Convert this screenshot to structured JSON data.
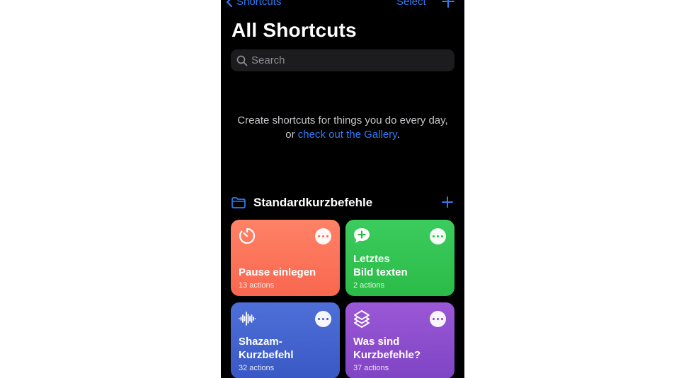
{
  "nav": {
    "back_label": "Shortcuts",
    "select_label": "Select"
  },
  "page": {
    "title": "All Shortcuts"
  },
  "search": {
    "placeholder": "Search"
  },
  "empty_state": {
    "line1": "Create shortcuts for things you do every day,",
    "line2_prefix": "or ",
    "link": "check out the Gallery",
    "line2_suffix": "."
  },
  "folder": {
    "title": "Standardkurzbefehle"
  },
  "colors": {
    "accent": "#2f7bf6",
    "background": "#000000"
  },
  "shortcuts": [
    {
      "name": "Pause einlegen",
      "count": "13 actions",
      "icon": "timer-icon",
      "color_top": "#ff8266",
      "color_bottom": "#f8674f"
    },
    {
      "name": "Letztes\nBild texten",
      "count": "2 actions",
      "icon": "message-plus-icon",
      "color_top": "#3ccc5e",
      "color_bottom": "#2bbb47"
    },
    {
      "name": "Shazam-\nKurzbefehl",
      "count": "32 actions",
      "icon": "waveform-icon",
      "color_top": "#4e6fd8",
      "color_bottom": "#3a58c4"
    },
    {
      "name": "Was sind\nKurzbefehle?",
      "count": "37 actions",
      "icon": "layers-icon",
      "color_top": "#9b58d6",
      "color_bottom": "#7f44c4"
    }
  ]
}
